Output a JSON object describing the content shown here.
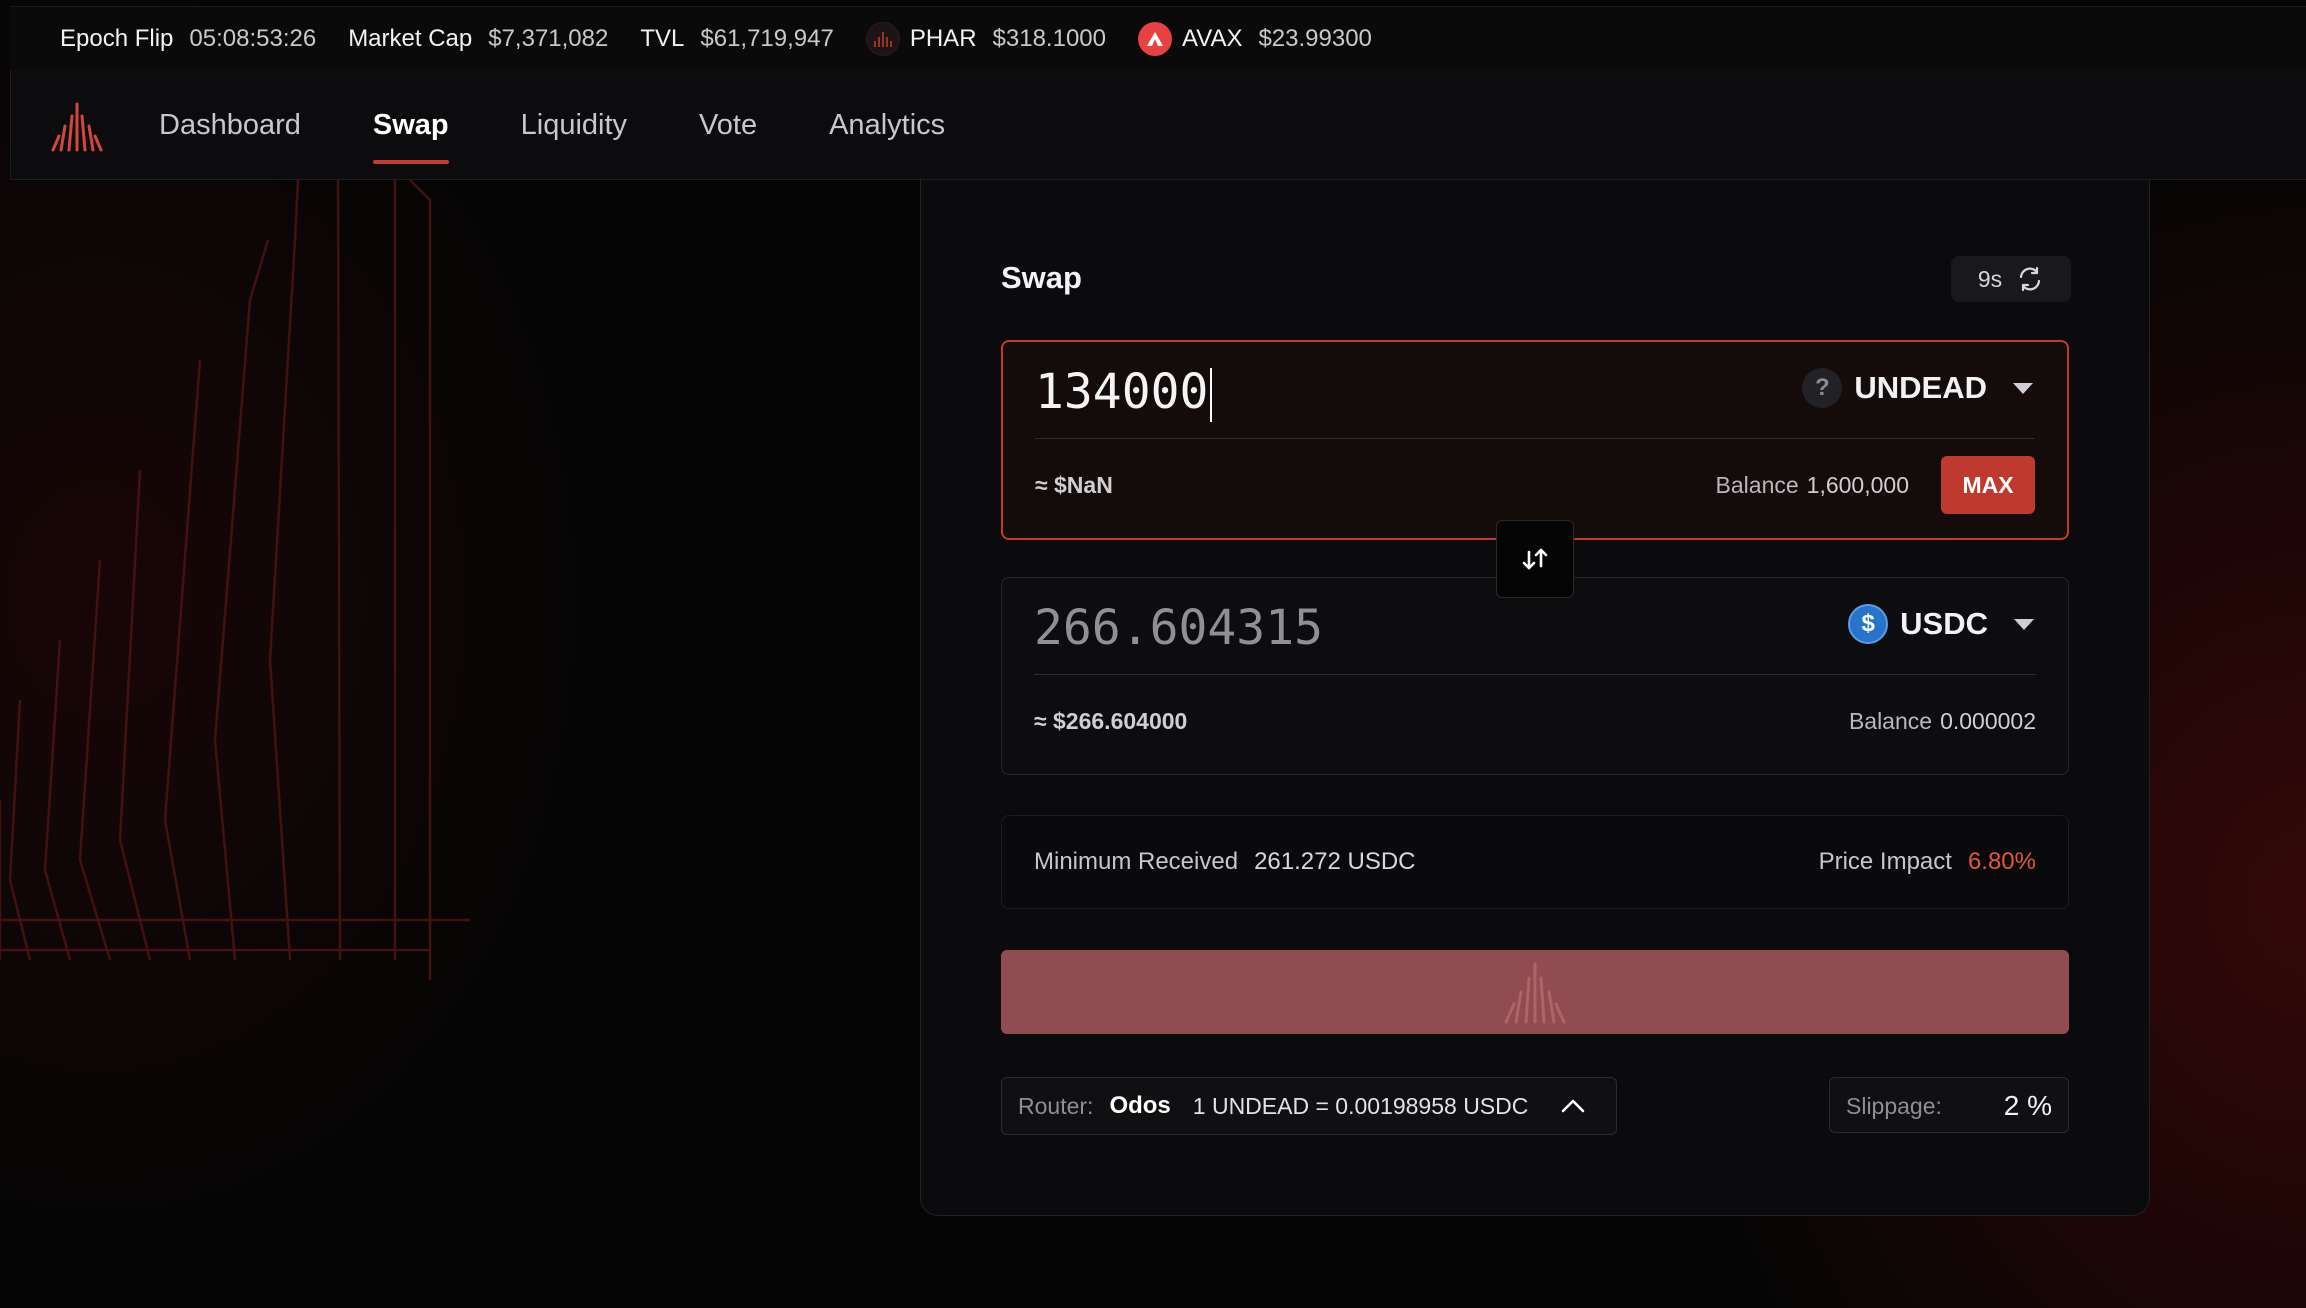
{
  "ticker": {
    "epoch_label": "Epoch Flip",
    "epoch_value": "05:08:53:26",
    "mcap_label": "Market Cap",
    "mcap_value": "$7,371,082",
    "tvl_label": "TVL",
    "tvl_value": "$61,719,947",
    "phar_label": "PHAR",
    "phar_value": "$318.1000",
    "avax_label": "AVAX",
    "avax_value": "$23.99300"
  },
  "nav": {
    "items": [
      {
        "label": "Dashboard"
      },
      {
        "label": "Swap",
        "active": true
      },
      {
        "label": "Liquidity"
      },
      {
        "label": "Vote"
      },
      {
        "label": "Analytics"
      }
    ]
  },
  "swap": {
    "title": "Swap",
    "refresh_countdown": "9s",
    "from": {
      "amount": "134000",
      "token": "UNDEAD",
      "token_icon": "question-icon",
      "usd_value": "≈ $NaN",
      "balance_label": "Balance",
      "balance_value": "1,600,000",
      "max_label": "MAX"
    },
    "to": {
      "amount": "266.604315",
      "token": "USDC",
      "token_icon": "usdc-icon",
      "usd_value": "≈ $266.604000",
      "balance_label": "Balance",
      "balance_value": "0.000002"
    },
    "info": {
      "min_label": "Minimum Received",
      "min_value": "261.272 USDC",
      "impact_label": "Price Impact",
      "impact_value": "6.80%"
    },
    "router": {
      "label": "Router:",
      "name": "Odos",
      "rate": "1 UNDEAD = 0.00198958 USDC"
    },
    "slippage": {
      "label": "Slippage:",
      "value": "2 %"
    }
  },
  "colors": {
    "accent": "#c0392e",
    "impact": "#e0573e",
    "cta": "#904c50",
    "usdc": "#2775ca",
    "avax": "#e84142"
  }
}
